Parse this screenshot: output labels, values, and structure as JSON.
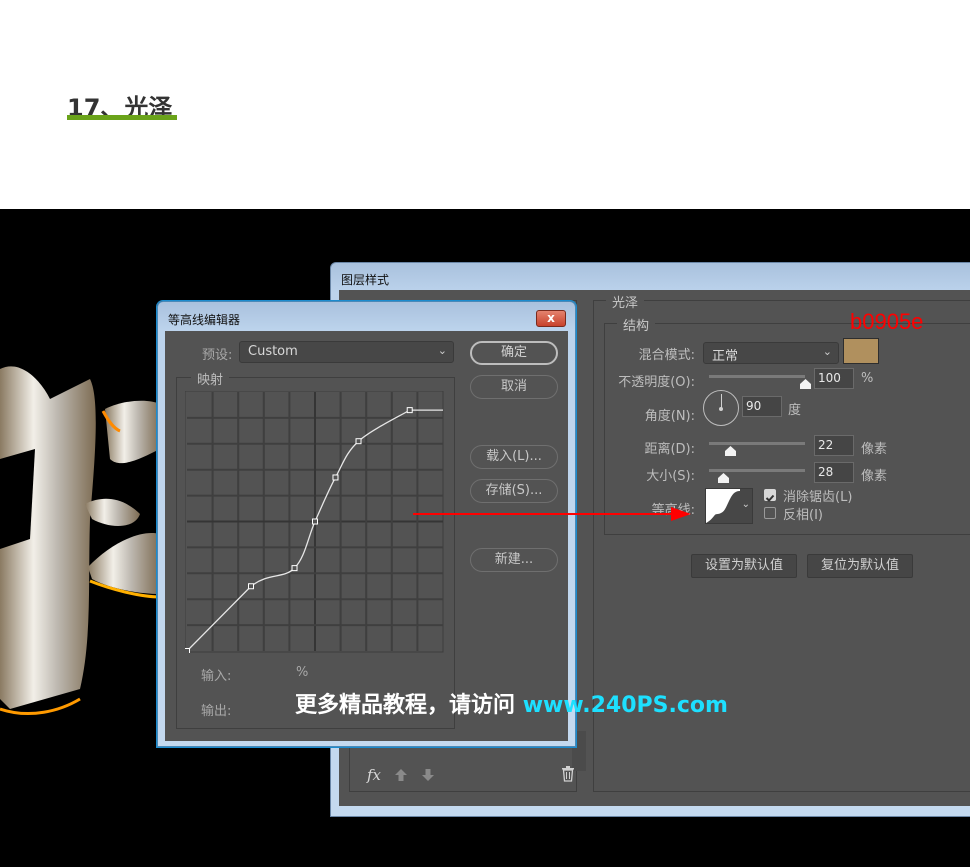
{
  "page": {
    "step_title": "17、光泽"
  },
  "layer_style": {
    "title": "图层样式",
    "section_label": "光泽",
    "structure_label": "结构",
    "blend_mode_label": "混合模式:",
    "blend_mode_value": "正常",
    "color_swatch": "#b0905e",
    "opacity_label": "不透明度(O):",
    "opacity_value": "100",
    "opacity_unit": "%",
    "opacity_fraction": 1.0,
    "angle_label": "角度(N):",
    "angle_value": "90",
    "angle_unit": "度",
    "distance_label": "距离(D):",
    "distance_value": "22",
    "distance_unit": "像素",
    "distance_fraction": 0.22,
    "size_label": "大小(S):",
    "size_value": "28",
    "size_unit": "像素",
    "size_fraction": 0.15,
    "contour_label": "等高线:",
    "antialias_label": "消除锯齿(L)",
    "antialias_checked": true,
    "invert_label": "反相(I)",
    "invert_checked": false,
    "set_default_button": "设置为默认值",
    "reset_default_button": "复位为默认值",
    "footer": {
      "fx_label": "fx"
    }
  },
  "annotation": {
    "hex_label": "b0905e",
    "hex_color": "#ff0000"
  },
  "contour_editor": {
    "title": "等高线编辑器",
    "close_label": "x",
    "preset_label": "预设:",
    "preset_value": "Custom",
    "mapping_label": "映射",
    "input_label": "输入:",
    "input_unit": "%",
    "output_label": "输出:",
    "buttons": {
      "ok": "确定",
      "cancel": "取消",
      "load": "载入(L)...",
      "save": "存储(S)...",
      "new": "新建..."
    },
    "curve_points": [
      {
        "in": 0,
        "out": 0
      },
      {
        "in": 25,
        "out": 25
      },
      {
        "in": 42,
        "out": 32
      },
      {
        "in": 50,
        "out": 50
      },
      {
        "in": 58,
        "out": 67
      },
      {
        "in": 67,
        "out": 81
      },
      {
        "in": 87,
        "out": 93
      }
    ],
    "curve_tail_out": 93
  },
  "watermark": {
    "text": "更多精品教程，请访问",
    "url": "www.240PS.com"
  }
}
